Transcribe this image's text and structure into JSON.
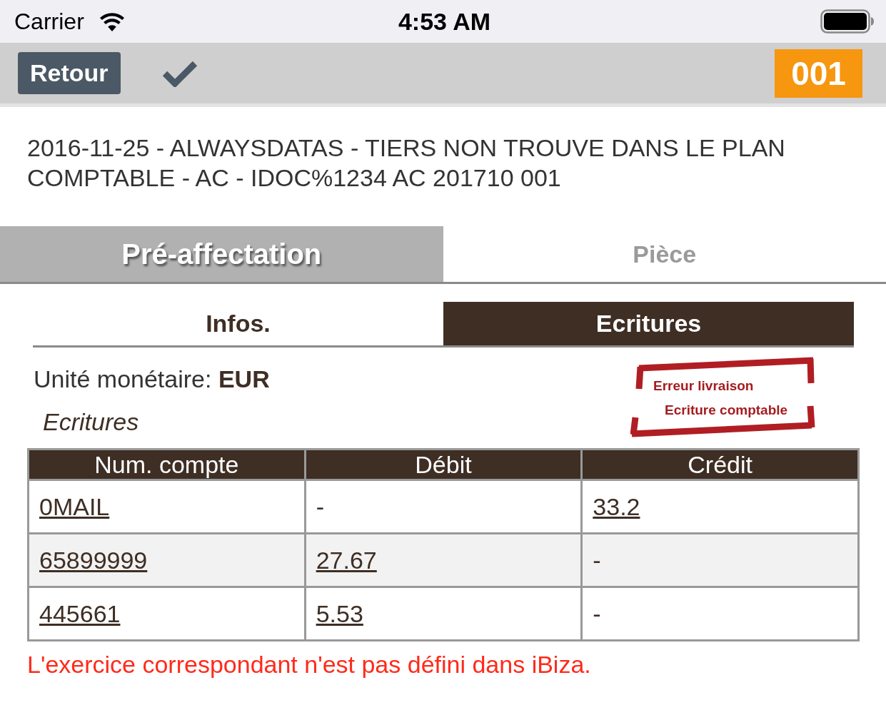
{
  "status_bar": {
    "carrier": "Carrier",
    "time": "4:53 AM"
  },
  "nav_bar": {
    "back_button": "Retour",
    "badge": "001"
  },
  "title": "2016-11-25 - ALWAYSDATAS - TIERS NON TROUVE DANS LE PLAN COMPTABLE - AC - IDOC%1234 AC 201710 001",
  "main_tabs": [
    {
      "label": "Pré-affectation",
      "selected": true
    },
    {
      "label": "Pièce",
      "selected": false
    }
  ],
  "sub_tabs": [
    {
      "label": "Infos.",
      "selected": false
    },
    {
      "label": "Ecritures",
      "selected": true
    }
  ],
  "currency": "Unité monétaire: **EUR**",
  "section_title": "Ecritures",
  "stamp": {
    "lines": [
      "Erreur livraison",
      "Ecriture comptable"
    ]
  },
  "table": {
    "columns": [
      "Num. compte",
      "Débit",
      "Crédit"
    ],
    "rows": [
      {
        "cells": [
          {
            "kind": "link",
            "text": "0MAIL"
          },
          {
            "kind": "text",
            "text": "-"
          },
          {
            "kind": "link",
            "text": "33.2"
          }
        ]
      },
      {
        "cells": [
          {
            "kind": "link",
            "text": "65899999"
          },
          {
            "kind": "link",
            "text": "27.67"
          },
          {
            "kind": "text",
            "text": "-"
          }
        ]
      },
      {
        "cells": [
          {
            "kind": "link",
            "text": "445661"
          },
          {
            "kind": "link",
            "text": "5.53"
          },
          {
            "kind": "text",
            "text": "-"
          }
        ]
      }
    ]
  },
  "error_message": "L'exercice correspondant n'est pas défini dans iBiza."
}
